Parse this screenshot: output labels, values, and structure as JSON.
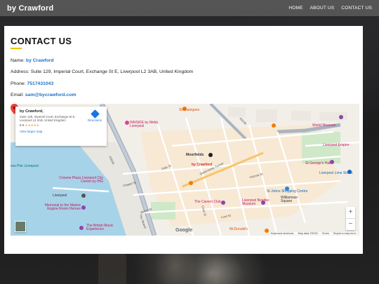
{
  "site": {
    "brand": "by Crawford",
    "nav": [
      "HOME",
      "ABOUT US",
      "CONTACT US"
    ]
  },
  "contact": {
    "title": "CONTACT US",
    "name_label": "Name:",
    "name_value": "by Crawford",
    "address_label": "Address:",
    "address_value": "Suite 129, Imperial Court, Exchange St E, Liverpool L2 3AB, United Kingdom",
    "phone_label": "Phone:",
    "phone_value": "7517431043",
    "email_label": "Email:",
    "email_value": "sam@bycrawford.com"
  },
  "map": {
    "info_title": "by Crawford,",
    "info_address": "Suite 129, Imperial Court, Exchange St E, Liverpool L2 3AB, United Kingdom",
    "rating": "5.0",
    "stars": "★★★★★",
    "view_larger": "View larger map",
    "directions": "Directions",
    "pin_label": "by Crawford",
    "zoom_in": "+",
    "zoom_out": "−",
    "google": "Google",
    "attribution": [
      "Keyboard shortcuts",
      "Map data ©2025",
      "Terms",
      "Report a map error"
    ],
    "labels": {
      "shenanigans": "Shenanigans",
      "world_museum": "World Museum",
      "innside": "INNSiDE by Meliá Liverpool",
      "moorfields": "Moorfields",
      "liverpool_empire": "Liverpool Empire",
      "george_hall": "St George's Hall",
      "lime_street": "Liverpool Lime Street",
      "river": "ess Pier Liverpool",
      "crowne_plaza": "Crowne Plaza Liverpool City Centre by IHG",
      "st_johns": "St Johns Shopping Centre",
      "williamson": "Williamson Square",
      "cavern": "The Cavern Club",
      "beatles": "Liverpool Beatles Museum",
      "memorial": "Memorial to the Marine Engine Room Heroes",
      "british_music": "The British Music Experience",
      "mcdonalds": "McDonald's",
      "cook_st": "Cook St",
      "water_st": "Water St",
      "chapel_st": "Chapel St",
      "queensway": "Queensway Tunnel",
      "victoria_st": "Victoria St",
      "dale_st": "Dale St",
      "lord_st": "Lord St",
      "the_strand": "The Strand",
      "a5036": "A5036",
      "a5038": "A5038",
      "liverpool_label": "Liverpool"
    }
  }
}
